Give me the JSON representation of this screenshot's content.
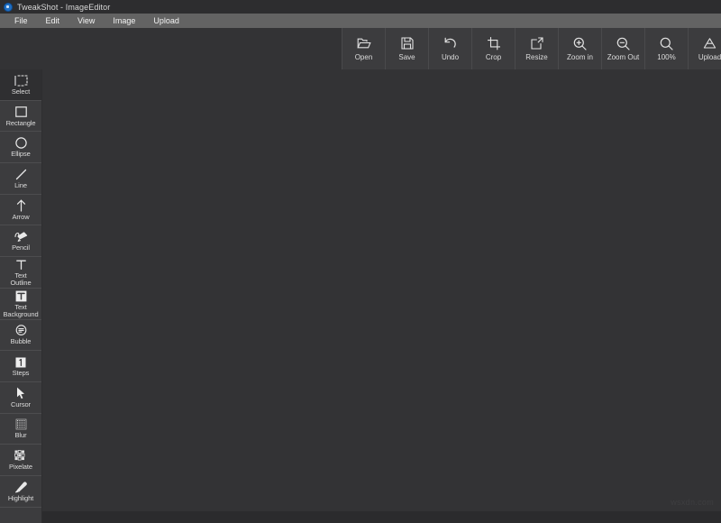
{
  "window": {
    "title": "TweakShot - ImageEditor",
    "icon": "app-circle-icon"
  },
  "menubar": {
    "items": [
      {
        "label": "File"
      },
      {
        "label": "Edit"
      },
      {
        "label": "View"
      },
      {
        "label": "Image"
      },
      {
        "label": "Upload"
      }
    ]
  },
  "toolbar": {
    "buttons": [
      {
        "label": "Open",
        "icon": "folder-open-icon"
      },
      {
        "label": "Save",
        "icon": "floppy-disk-icon"
      },
      {
        "label": "Undo",
        "icon": "undo-arrow-icon"
      },
      {
        "label": "Crop",
        "icon": "crop-icon"
      },
      {
        "label": "Resize",
        "icon": "resize-icon"
      },
      {
        "label": "Zoom in",
        "icon": "magnifier-plus-icon"
      },
      {
        "label": "Zoom Out",
        "icon": "magnifier-minus-icon"
      },
      {
        "label": "100%",
        "icon": "magnifier-icon"
      },
      {
        "label": "Upload",
        "icon": "upload-drive-icon",
        "has_dropdown": true
      }
    ]
  },
  "sidebar": {
    "tools": [
      {
        "label": "Select",
        "icon": "selection-marquee-icon",
        "active": true
      },
      {
        "label": "Rectangle",
        "icon": "rectangle-icon",
        "active": false
      },
      {
        "label": "Ellipse",
        "icon": "ellipse-icon",
        "active": false
      },
      {
        "label": "Line",
        "icon": "line-icon",
        "active": false
      },
      {
        "label": "Arrow",
        "icon": "arrow-up-icon",
        "active": false
      },
      {
        "label": "Pencil",
        "icon": "pencil-icon",
        "active": false
      },
      {
        "label": "Text\nOutline",
        "icon": "text-outline-icon",
        "active": false
      },
      {
        "label": "Text\nBackground",
        "icon": "text-background-icon",
        "active": false
      },
      {
        "label": "Bubble",
        "icon": "speech-bubble-icon",
        "active": false
      },
      {
        "label": "Steps",
        "icon": "steps-number-icon",
        "active": false
      },
      {
        "label": "Cursor",
        "icon": "mouse-cursor-icon",
        "active": false
      },
      {
        "label": "Blur",
        "icon": "blur-icon",
        "active": false
      },
      {
        "label": "Pixelate",
        "icon": "pixelate-icon",
        "active": false
      },
      {
        "label": "Highlight",
        "icon": "highlighter-pen-icon",
        "active": false
      }
    ]
  },
  "canvas": {
    "watermark": "wsxdn.com"
  },
  "colors": {
    "titlebar_bg": "#2d2d2f",
    "menubar_bg": "#636363",
    "panel_bg": "#3c3c3e",
    "canvas_bg": "#333335",
    "active_tool_bg": "#2f2f31",
    "text": "#dcdcdc",
    "app_icon_blue": "#1f6fc4"
  }
}
